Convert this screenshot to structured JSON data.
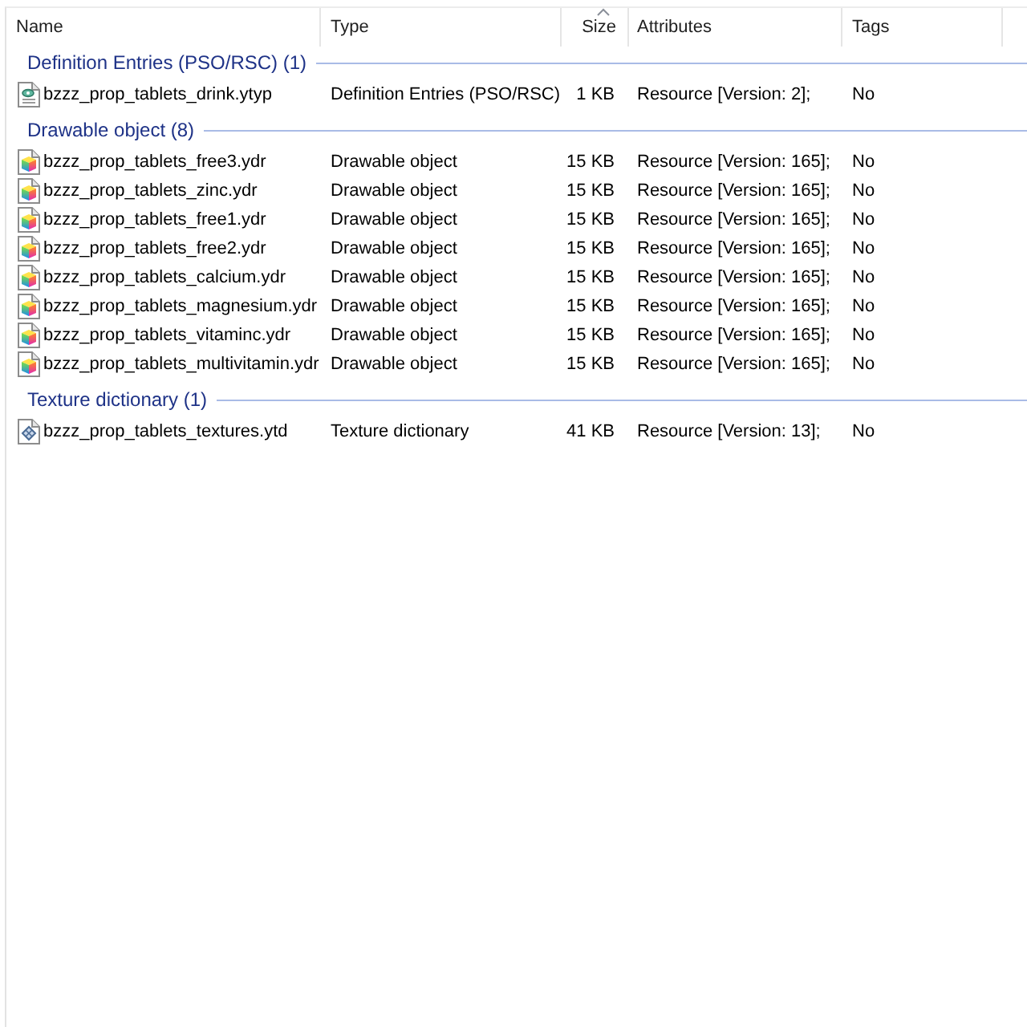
{
  "columns": [
    {
      "label": "Name",
      "sorted": false
    },
    {
      "label": "Type",
      "sorted": false
    },
    {
      "label": "Size",
      "sorted": true
    },
    {
      "label": "Attributes",
      "sorted": false
    },
    {
      "label": "Tags",
      "sorted": false
    }
  ],
  "groups": [
    {
      "title": "Definition Entries (PSO/RSC) (1)",
      "items": [
        {
          "kind": "definition",
          "name": "bzzz_prop_tablets_drink.ytyp",
          "type": "Definition Entries (PSO/RSC)",
          "size": "1 KB",
          "attributes": "Resource [Version: 2];",
          "tags": "No",
          "selected": false
        }
      ]
    },
    {
      "title": "Drawable object (8)",
      "items": [
        {
          "kind": "drawable",
          "name": "bzzz_prop_tablets_free3.ydr",
          "type": "Drawable object",
          "size": "15 KB",
          "attributes": "Resource [Version: 165];",
          "tags": "No",
          "selected": false
        },
        {
          "kind": "drawable",
          "name": "bzzz_prop_tablets_zinc.ydr",
          "type": "Drawable object",
          "size": "15 KB",
          "attributes": "Resource [Version: 165];",
          "tags": "No",
          "selected": false
        },
        {
          "kind": "drawable",
          "name": "bzzz_prop_tablets_free1.ydr",
          "type": "Drawable object",
          "size": "15 KB",
          "attributes": "Resource [Version: 165];",
          "tags": "No",
          "selected": false
        },
        {
          "kind": "drawable",
          "name": "bzzz_prop_tablets_free2.ydr",
          "type": "Drawable object",
          "size": "15 KB",
          "attributes": "Resource [Version: 165];",
          "tags": "No",
          "selected": false
        },
        {
          "kind": "drawable",
          "name": "bzzz_prop_tablets_calcium.ydr",
          "type": "Drawable object",
          "size": "15 KB",
          "attributes": "Resource [Version: 165];",
          "tags": "No",
          "selected": false
        },
        {
          "kind": "drawable",
          "name": "bzzz_prop_tablets_magnesium.ydr",
          "type": "Drawable object",
          "size": "15 KB",
          "attributes": "Resource [Version: 165];",
          "tags": "No",
          "selected": false
        },
        {
          "kind": "drawable",
          "name": "bzzz_prop_tablets_vitaminc.ydr",
          "type": "Drawable object",
          "size": "15 KB",
          "attributes": "Resource [Version: 165];",
          "tags": "No",
          "selected": false
        },
        {
          "kind": "drawable",
          "name": "bzzz_prop_tablets_multivitamin.ydr",
          "type": "Drawable object",
          "size": "15 KB",
          "attributes": "Resource [Version: 165];",
          "tags": "No",
          "selected": false
        }
      ]
    },
    {
      "title": "Texture dictionary (1)",
      "items": [
        {
          "kind": "texture",
          "name": "bzzz_prop_tablets_textures.ytd",
          "type": "Texture dictionary",
          "size": "41 KB",
          "attributes": "Resource [Version: 13];",
          "tags": "No",
          "selected": false
        }
      ]
    }
  ]
}
